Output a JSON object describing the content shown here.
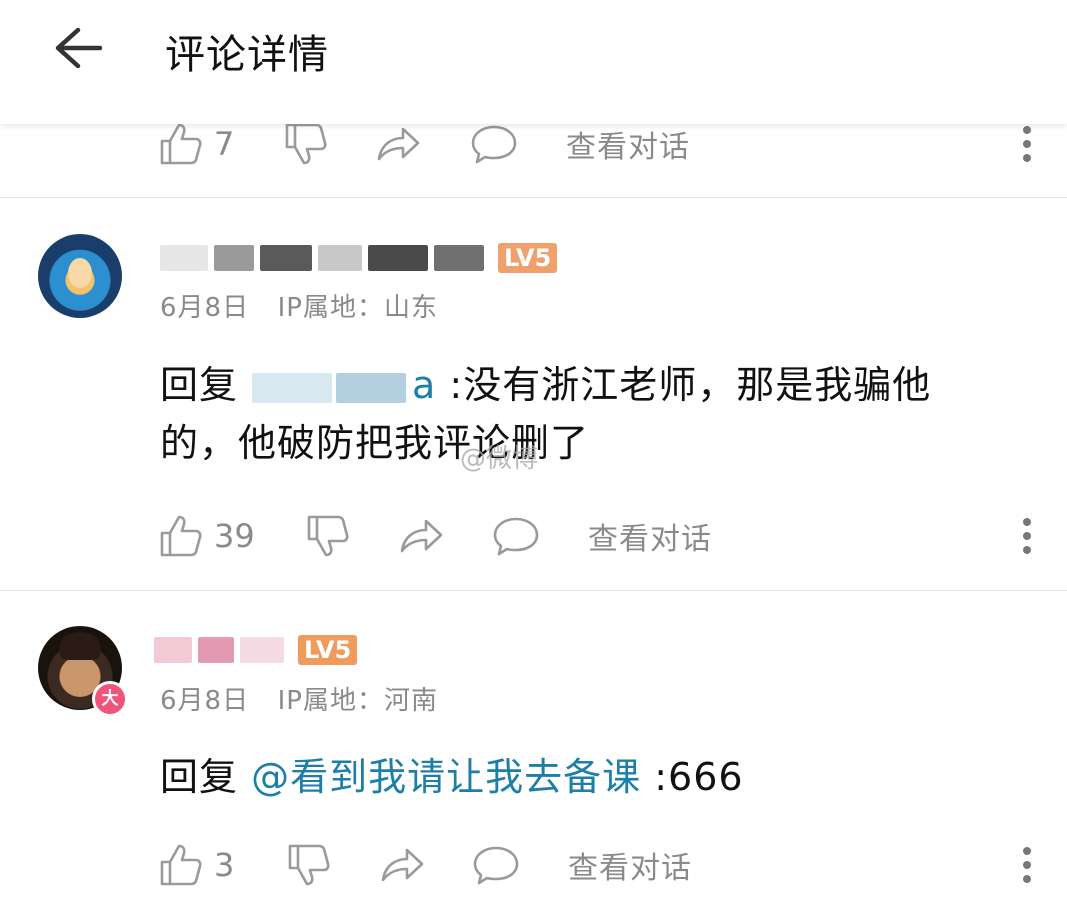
{
  "header": {
    "title": "评论详情",
    "back_icon": "arrow-left-icon"
  },
  "top_actions": {
    "like_count": "7",
    "conversation_label": "查看对话"
  },
  "comments": [
    {
      "user_level": "LV5",
      "date": "6月8日",
      "ip_location": "IP属地：山东",
      "reply_prefix": "回复",
      "reply_mention": "a",
      "reply_line1": ":没有浙江老师，那是我骗他",
      "reply_line2": "的，他破防把我评论删了",
      "like_count": "39",
      "conversation_label": "查看对话"
    },
    {
      "user_level": "LV5",
      "avatar_badge": "大",
      "date": "6月8日",
      "ip_location": "IP属地：河南",
      "reply_prefix": "回复",
      "reply_mention": "@看到我请让我去备课",
      "reply_text": ":666",
      "like_count": "3",
      "conversation_label": "查看对话"
    }
  ],
  "watermark": "@微博"
}
